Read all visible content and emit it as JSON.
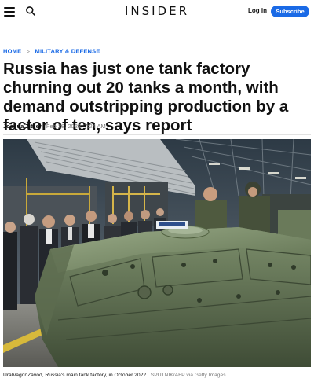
{
  "header": {
    "logo": "INSIDER",
    "login_label": "Log in",
    "subscribe_label": "Subscribe",
    "accent_color": "#1a6ae6"
  },
  "breadcrumb": {
    "items": [
      "HOME",
      "MILITARY & DEFENSE"
    ],
    "separator": ">"
  },
  "article": {
    "headline": "Russia has just one tank factory churning out 20 tanks a month, with demand outstripping production by a factor of ten, says report",
    "author": "Joshua Zitser",
    "timestamp": "Feb 28, 2023, 7:24 AM"
  },
  "image": {
    "caption": "UralVagonZavod, Russia's main tank factory, in October 2022.",
    "credit": "SPUTNIK/AFP via Getty Images"
  },
  "icons": {
    "menu": "menu-icon",
    "search": "search-icon"
  }
}
